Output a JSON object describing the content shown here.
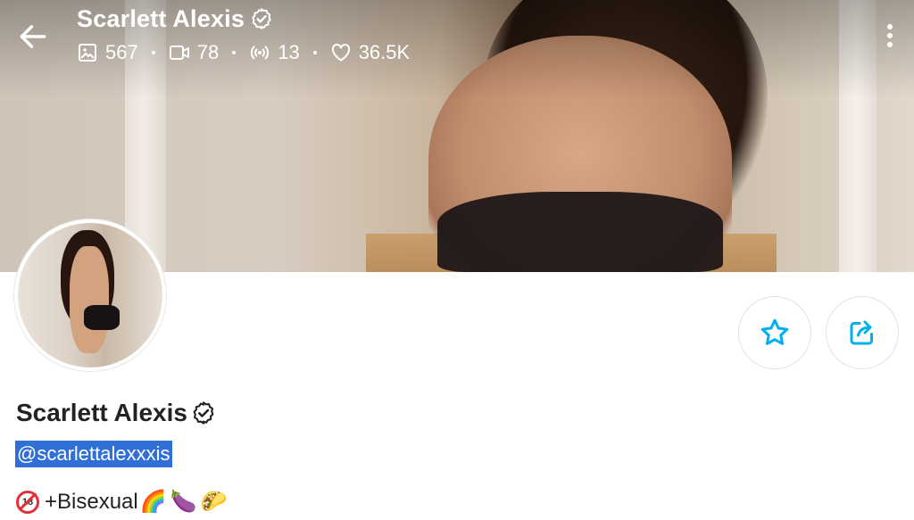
{
  "header": {
    "name": "Scarlett Alexis",
    "stats": [
      {
        "icon": "image-icon",
        "value": "567"
      },
      {
        "icon": "video-icon",
        "value": "78"
      },
      {
        "icon": "live-stream-icon",
        "value": "13"
      },
      {
        "icon": "heart-icon",
        "value": "36.5K"
      }
    ]
  },
  "profile": {
    "name": "Scarlett Alexis",
    "handle": "@scarlettalexxxis",
    "bio": {
      "badge": "18",
      "text": "+Bisexual",
      "emojis": [
        "🌈",
        "🍆",
        "🌮"
      ]
    }
  },
  "colors": {
    "accent": "#00aff0",
    "selection": "#2f6fd6",
    "no_badge": "#e0303a"
  }
}
